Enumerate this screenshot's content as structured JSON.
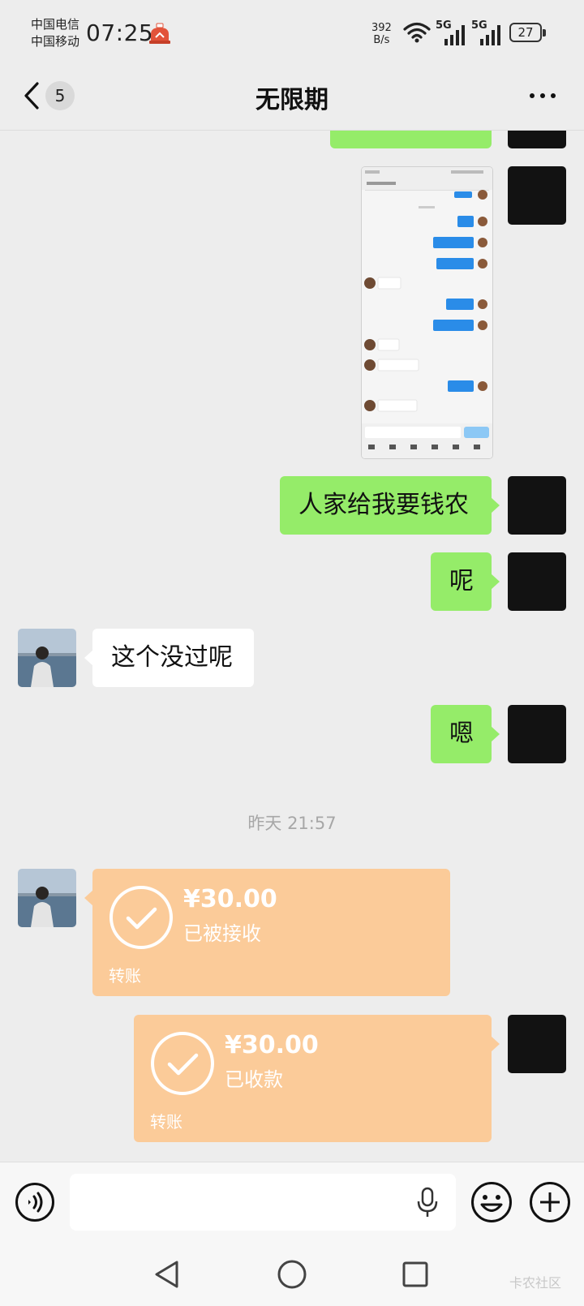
{
  "status_bar": {
    "carrier1": "中国电信",
    "carrier2": "中国移动",
    "time": "07:25",
    "net_speed_value": "392",
    "net_speed_unit": "B/s",
    "sig1_label": "5G",
    "sig2_label": "5G",
    "battery": "27"
  },
  "header": {
    "unread_count": "5",
    "title": "无限期"
  },
  "messages": {
    "m1": "人家给我要钱农",
    "m2": "呢",
    "m3": "这个没过呢",
    "m4": "嗯"
  },
  "time_divider": "昨天 21:57",
  "transfer_received": {
    "amount": "¥30.00",
    "status": "已被接收",
    "label": "转账"
  },
  "transfer_sent": {
    "amount": "¥30.00",
    "status": "已收款",
    "label": "转账"
  },
  "input": {
    "value": ""
  },
  "watermark": "卡农社区",
  "colors": {
    "background": "#ededed",
    "my_bubble": "#95ec69",
    "other_bubble": "#ffffff",
    "transfer_card": "#fbcb99"
  }
}
